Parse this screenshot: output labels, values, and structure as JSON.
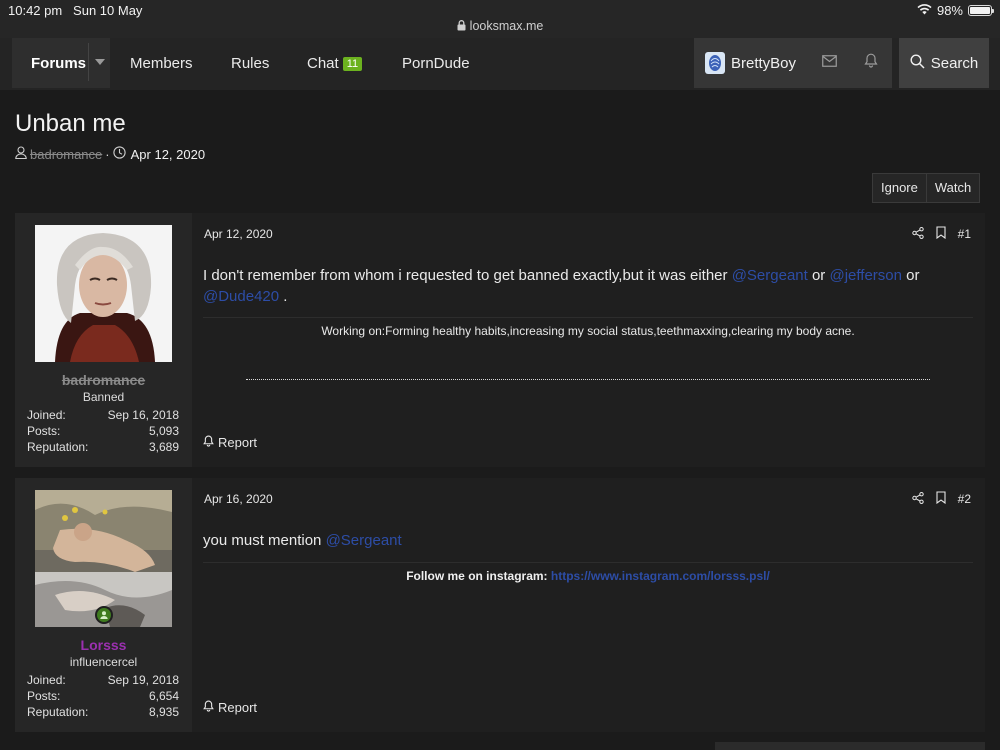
{
  "status_bar": {
    "time": "10:42 pm",
    "date": "Sun 10 May",
    "url": "looksmax.me",
    "battery": "98%",
    "battery_level": 0.98
  },
  "nav": {
    "forums": "Forums",
    "members": "Members",
    "rules": "Rules",
    "chat": "Chat",
    "chat_count": "11",
    "porndude": "PornDude",
    "username": "BrettyBoy",
    "search": "Search"
  },
  "thread": {
    "title": "Unban me",
    "author": "badromance",
    "date": "Apr 12, 2020",
    "ignore": "Ignore",
    "watch": "Watch"
  },
  "posts": [
    {
      "username": "badromance",
      "user_title": "Banned",
      "joined_label": "Joined:",
      "joined": "Sep 16, 2018",
      "posts_label": "Posts:",
      "posts": "5,093",
      "rep_label": "Reputation:",
      "reputation": "3,689",
      "date": "Apr 12, 2020",
      "number": "#1",
      "body_text": "I don't remember from whom i requested to get banned exactly,but it was either ",
      "mention_1": "@Sergeant",
      "or_1": " or ",
      "mention_2": "@jefferson",
      "or_2": " or ",
      "mention_3": "@Dude420",
      "body_end": " .",
      "signature": "Working on:Forming healthy habits,increasing my social status,teethmaxxing,clearing my body acne.",
      "report": "Report"
    },
    {
      "username": "Lorsss",
      "user_title": "influencercel",
      "joined_label": "Joined:",
      "joined": "Sep 19, 2018",
      "posts_label": "Posts:",
      "posts": "6,654",
      "rep_label": "Reputation:",
      "reputation": "8,935",
      "date": "Apr 16, 2020",
      "number": "#2",
      "body_text": "you must mention ",
      "mention_1": "@Sergeant",
      "sig_label": "Follow me on instagram: ",
      "sig_link": "https://www.instagram.com/lorsss.psl/",
      "report": "Report"
    }
  ],
  "colors": {
    "mention": "#2d4da6",
    "banned_name": "#8a8a8a",
    "lorsss_name": "#9b30b0",
    "chat_badge": "#6cb21f",
    "online": "#3e7b1e"
  }
}
